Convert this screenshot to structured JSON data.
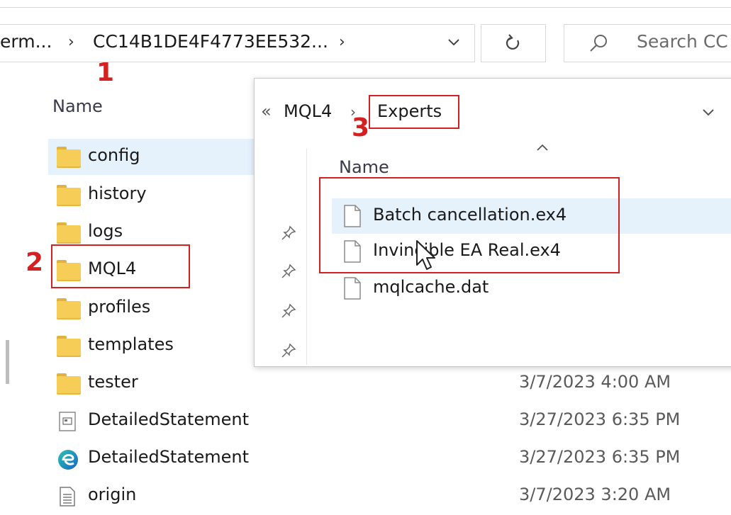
{
  "address_bar": {
    "crumb1": "erm...",
    "crumb2": "CC14B1DE4F4773EE532...",
    "dropdown_icon": "chevron-down-icon",
    "refresh_icon": "refresh-icon"
  },
  "search": {
    "placeholder": "Search CC",
    "icon": "search-icon"
  },
  "annotations": {
    "n1": "1",
    "n2": "2",
    "n3": "3",
    "color": "#d42020"
  },
  "list": {
    "name_header": "Name",
    "rows": [
      {
        "name": "config",
        "type": "folder",
        "date": ""
      },
      {
        "name": "history",
        "type": "folder",
        "date": ""
      },
      {
        "name": "logs",
        "type": "folder",
        "date": ""
      },
      {
        "name": "MQL4",
        "type": "folder",
        "date": ""
      },
      {
        "name": "profiles",
        "type": "folder",
        "date": ""
      },
      {
        "name": "templates",
        "type": "folder",
        "date": ""
      },
      {
        "name": "tester",
        "type": "folder",
        "date": "3/7/2023 4:00 AM"
      },
      {
        "name": "DetailedStatement",
        "type": "htm-file",
        "date": "3/27/2023 6:35 PM"
      },
      {
        "name": "DetailedStatement",
        "type": "edge-file",
        "date": "3/27/2023 6:35 PM"
      },
      {
        "name": "origin",
        "type": "text-file",
        "date": "3/7/2023 3:20 AM"
      }
    ]
  },
  "popup": {
    "back_glyph": "«",
    "crumb1": "MQL4",
    "crumb2": "Experts",
    "dropdown_icon": "chevron-down-icon",
    "name_header": "Name",
    "files": [
      {
        "name": "Batch cancellation.ex4"
      },
      {
        "name": "Invincible EA Real.ex4"
      },
      {
        "name": "mqlcache.dat"
      }
    ]
  },
  "colors": {
    "highlight": "#e5f1fb",
    "folder": "#f6cd57",
    "border": "#d9d9d9"
  }
}
